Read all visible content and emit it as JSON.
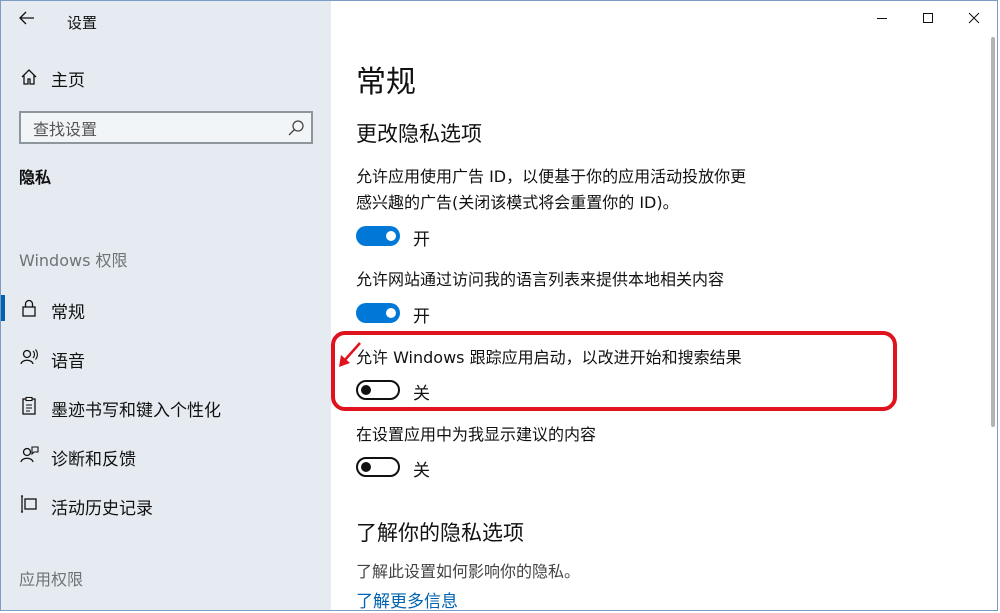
{
  "window": {
    "title": "设置",
    "controls": [
      "minimize",
      "maximize",
      "close"
    ]
  },
  "sidebar": {
    "home_label": "主页",
    "search_placeholder": "查找设置",
    "section_title": "隐私",
    "groups": [
      {
        "label": "Windows 权限",
        "items": [
          {
            "label": "常规",
            "icon": "lock-icon",
            "active": true
          },
          {
            "label": "语音",
            "icon": "speech-icon",
            "active": false
          },
          {
            "label": "墨迹书写和键入个性化",
            "icon": "clipboard-icon",
            "active": false
          },
          {
            "label": "诊断和反馈",
            "icon": "feedback-icon",
            "active": false
          },
          {
            "label": "活动历史记录",
            "icon": "timeline-icon",
            "active": false
          }
        ]
      },
      {
        "label": "应用权限",
        "items": []
      }
    ]
  },
  "main": {
    "title": "常规",
    "subtitle": "更改隐私选项",
    "settings": [
      {
        "text_line1": "允许应用使用广告 ID，以便基于你的应用活动投放你更",
        "text_line2": "感兴趣的广告(关闭该模式将会重置你的 ID)。",
        "state": "开",
        "on": true
      },
      {
        "text_line1": "允许网站通过访问我的语言列表来提供本地相关内容",
        "text_line2": "",
        "state": "开",
        "on": true
      },
      {
        "text_line1": "允许 Windows 跟踪应用启动，以改进开始和搜索结果",
        "text_line2": "",
        "state": "关",
        "on": false,
        "highlighted": true
      },
      {
        "text_line1": "在设置应用中为我显示建议的内容",
        "text_line2": "",
        "state": "关",
        "on": false
      }
    ],
    "learn": {
      "title": "了解你的隐私选项",
      "description": "了解此设置如何影响你的隐私。",
      "link": "了解更多信息"
    }
  },
  "colors": {
    "accent": "#0078d7",
    "link": "#0063b1",
    "sidebar_bg": "#e5ebf0",
    "highlight": "#e0121d"
  }
}
